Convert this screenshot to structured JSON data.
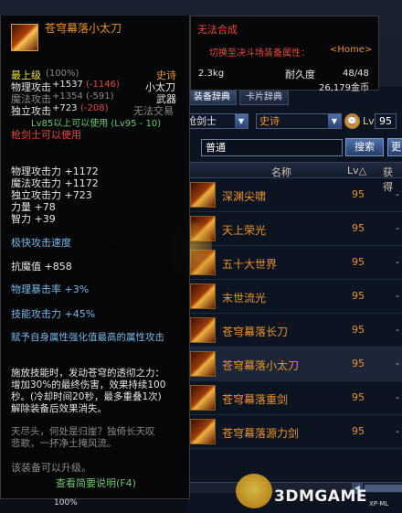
{
  "tabs": [
    "装备辞典",
    "卡片辞典"
  ],
  "filters": {
    "class": "枪剑士",
    "rarity": "史诗",
    "lv_label": "Lv",
    "lv_value": "95"
  },
  "search": {
    "value": "普通",
    "button": "搜索",
    "extra": "更"
  },
  "table_headers": {
    "name": "名称",
    "lv": "Lv△",
    "get": "获得"
  },
  "items": [
    {
      "name": "深渊尖啸",
      "lv": "95",
      "get": "-"
    },
    {
      "name": "天上荣光",
      "lv": "95",
      "get": "-"
    },
    {
      "name": "五十大世界",
      "lv": "95",
      "get": "-"
    },
    {
      "name": "末世流光",
      "lv": "95",
      "get": "-"
    },
    {
      "name": "苍穹幕落长刀",
      "lv": "95",
      "get": "-"
    },
    {
      "name": "苍穹幕落小太刀",
      "lv": "95",
      "get": "-"
    },
    {
      "name": "苍穹幕落重剑",
      "lv": "95",
      "get": "-"
    },
    {
      "name": "苍穹幕落源力剑",
      "lv": "95",
      "get": "-"
    }
  ],
  "scroll": {
    "left_arrow": "◀"
  },
  "tooltip": {
    "name": "苍穹幕落小太刀",
    "grade_label": "最上级",
    "grade_pct": "(100%)",
    "rarity": "史诗",
    "phys_atk_label": "物理攻击",
    "phys_atk_val": "+1537",
    "phys_atk_diff": "(-1146)",
    "type_name": "小太刀",
    "mag_atk_label": "魔法攻击",
    "mag_atk_val": "+1354",
    "mag_atk_diff": "(-591)",
    "category": "武器",
    "ind_atk_label": "独立攻击",
    "ind_atk_val": "+723",
    "ind_atk_diff": "(-208)",
    "trade": "无法交易",
    "level_req": "Lv85以上可以使用 (Lv95 - 10)",
    "class_req": "枪剑士可以使用",
    "stats": [
      "物理攻击力 +1172",
      "魔法攻击力 +1172",
      "独立攻击力 +723",
      "力量 +78",
      "智力 +39"
    ],
    "speed": "极快攻击速度",
    "resist": "抗魔值 +858",
    "crit": "物理暴击率 +3%",
    "skill_atk": "技能攻击力 +45%",
    "element": "赋予自身属性强化值最高的属性攻击",
    "effect": [
      "施放技能时，发动苍穹的透彻之力：",
      "增加30%的最终伤害，效果持续100",
      "秒。(冷却时间20秒，最多重叠1次)",
      "解除装备后效果消失。"
    ],
    "flavor": [
      "天尽头，何处是归崖？独倚长天叹",
      "悲歌，一抔净土掩风流。"
    ],
    "upgrade": "该装备可以升级。",
    "footer": "查看简要说明(F4)"
  },
  "infobox": {
    "cannot_synth": "无法合成",
    "switch": "切换至决斗场装备属性：",
    "home_key": "<Home>",
    "weight": "2.3kg",
    "durability_label": "耐久度",
    "durability_value": "48/48",
    "price": "26,179金币"
  },
  "bottom": {
    "pct": "100%"
  },
  "watermark": {
    "main": "3DMGAME",
    "sub": "XP·ML"
  }
}
